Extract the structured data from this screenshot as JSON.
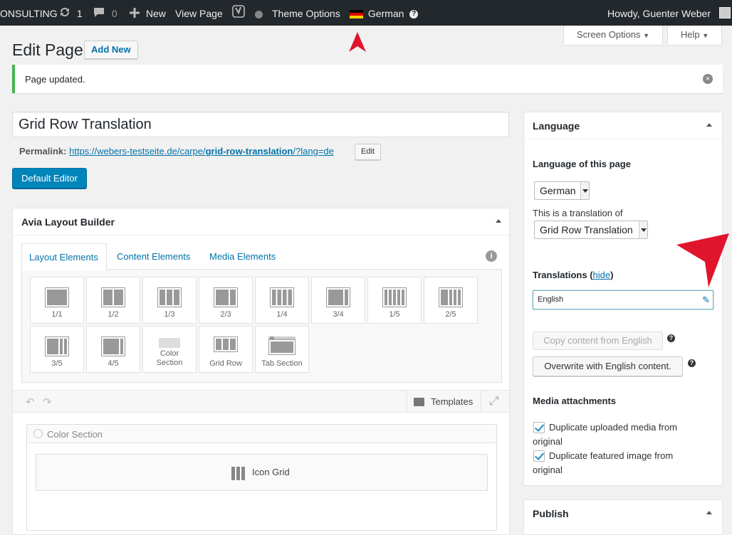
{
  "adminbar": {
    "site": "ONSULTING",
    "updates": "1",
    "comments": "0",
    "new": "New",
    "view_page": "View Page",
    "theme_options": "Theme Options",
    "language": "German",
    "howdy": "Howdy, Guenter Weber"
  },
  "screen": {
    "screen_options": "Screen Options",
    "help": "Help"
  },
  "page": {
    "title": "Edit Page",
    "add_new": "Add New",
    "notice": "Page updated.",
    "post_title": "Grid Row Translation",
    "permalink_label": "Permalink:",
    "permalink_pre": "https://webers-testseite.de/carpe/",
    "permalink_slug": "grid-row-translation",
    "permalink_post": "/?lang=de",
    "edit": "Edit",
    "default_editor": "Default Editor"
  },
  "builder": {
    "title": "Avia Layout Builder",
    "tabs": [
      "Layout Elements",
      "Content Elements",
      "Media Elements"
    ],
    "elements": [
      "1/1",
      "1/2",
      "1/3",
      "2/3",
      "1/4",
      "3/4",
      "1/5",
      "2/5",
      "3/5",
      "4/5",
      "Color Section",
      "Grid Row",
      "Tab Section"
    ],
    "templates": "Templates",
    "color_section": "Color Section",
    "icon_grid": "Icon Grid"
  },
  "language_box": {
    "title": "Language",
    "lang_of_page": "Language of this page",
    "lang_value": "German",
    "translation_of": "This is a translation of",
    "translation_value": "Grid Row Translation",
    "translations": "Translations (",
    "hide": "hide",
    "translations_close": ")",
    "english": "English",
    "copy": "Copy content from English",
    "overwrite": "Overwrite with English content.",
    "media": "Media attachments",
    "dup_media": "Duplicate uploaded media from original",
    "dup_featured": "Duplicate featured image from original"
  },
  "publish": {
    "title": "Publish"
  },
  "colors": {
    "accent": "#0073aa",
    "button": "#0085ba",
    "arrow": "#e0142c",
    "notice": "#46b450"
  }
}
